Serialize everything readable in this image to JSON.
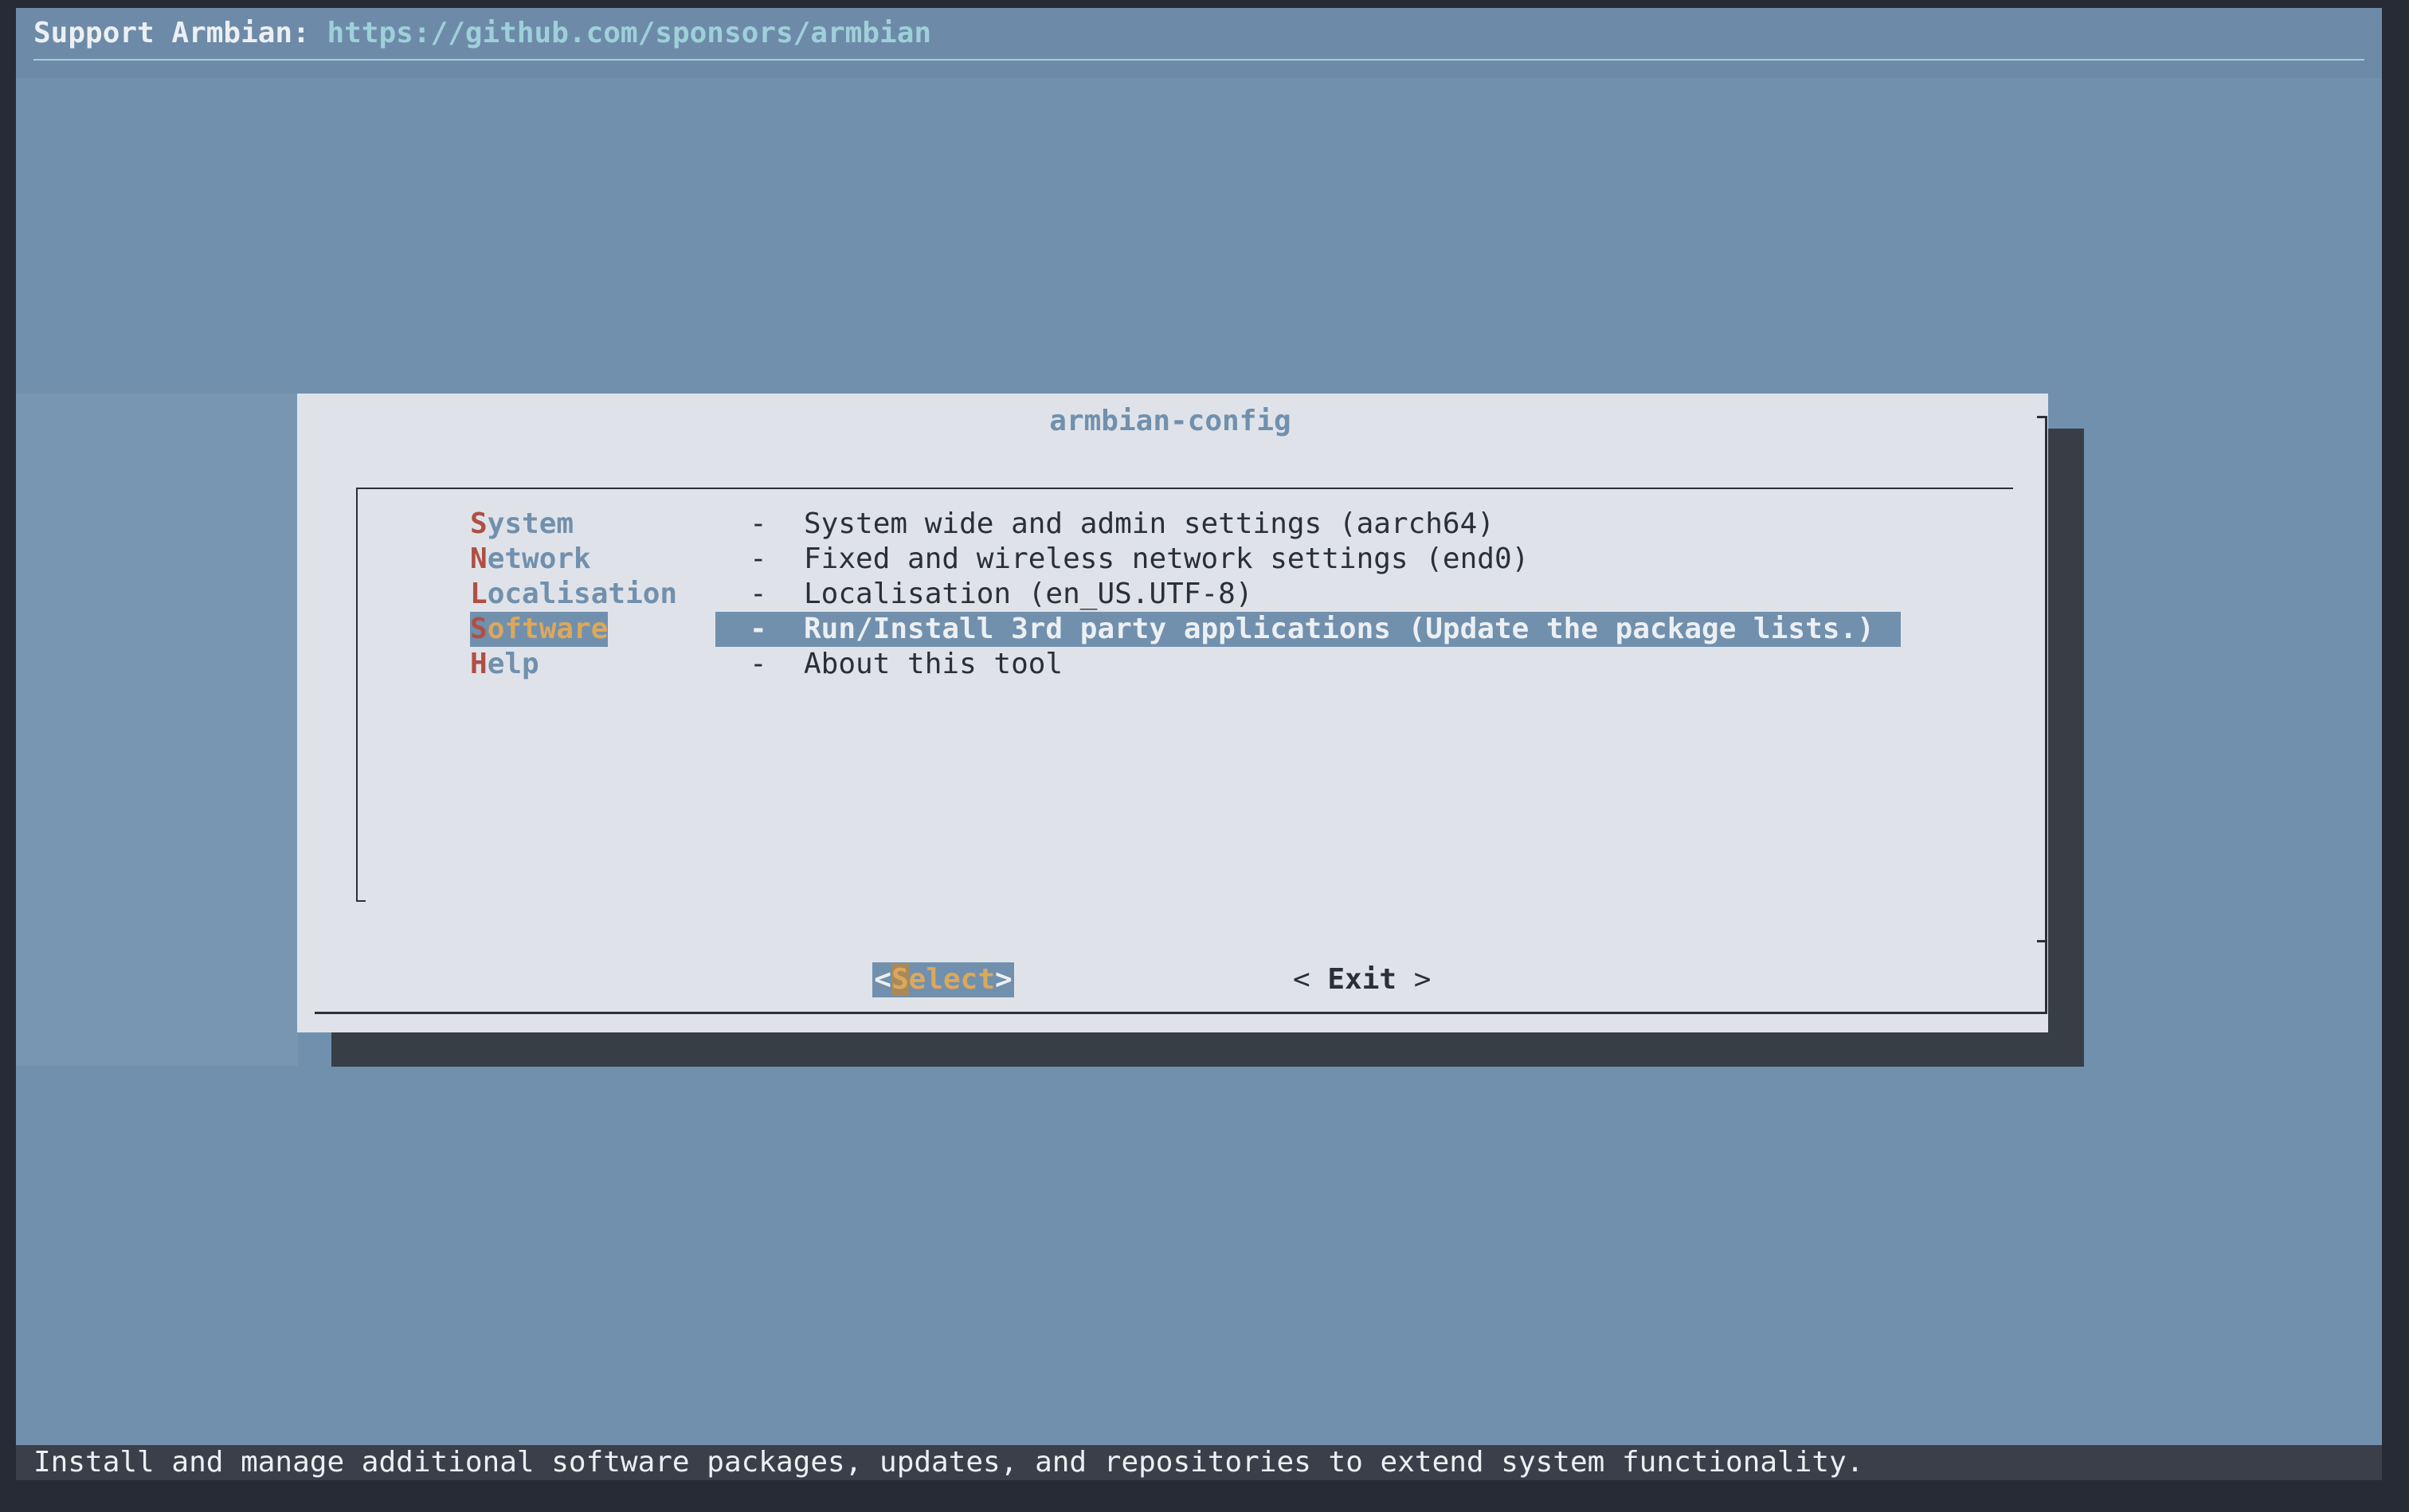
{
  "header": {
    "label": "Support Armbian: ",
    "link": "https://github.com/sponsors/armbian"
  },
  "dialog": {
    "title": "armbian-config",
    "items": [
      {
        "hot": "S",
        "rest": "ystem",
        "dash": "-",
        "desc": "System wide and admin settings (aarch64)"
      },
      {
        "hot": "N",
        "rest": "etwork",
        "dash": "-",
        "desc": "Fixed and wireless network settings (end0)"
      },
      {
        "hot": "L",
        "rest": "ocalisation",
        "dash": "-",
        "desc": "Localisation (en_US.UTF-8)"
      },
      {
        "hot": "S",
        "rest": "oftware",
        "dash": "-",
        "desc": "Run/Install 3rd party applications (Update the package lists.)"
      },
      {
        "hot": "H",
        "rest": "elp",
        "dash": "-",
        "desc": "About this tool"
      }
    ],
    "selected_index": 3,
    "buttons": {
      "select": {
        "left": "<",
        "hot": "S",
        "rest": "elect",
        "right": ">"
      },
      "exit": {
        "left": "< ",
        "label": "Exit",
        "right": " >"
      }
    }
  },
  "statusbar": {
    "text": "Install and manage additional software packages, updates, and repositories to extend system functionality."
  },
  "colors": {
    "background": "#7190ad",
    "dialog": "#dfe3e9",
    "shadow": "#383e46",
    "hotkey": "#b04f45",
    "highlight_text": "#dca85b"
  }
}
